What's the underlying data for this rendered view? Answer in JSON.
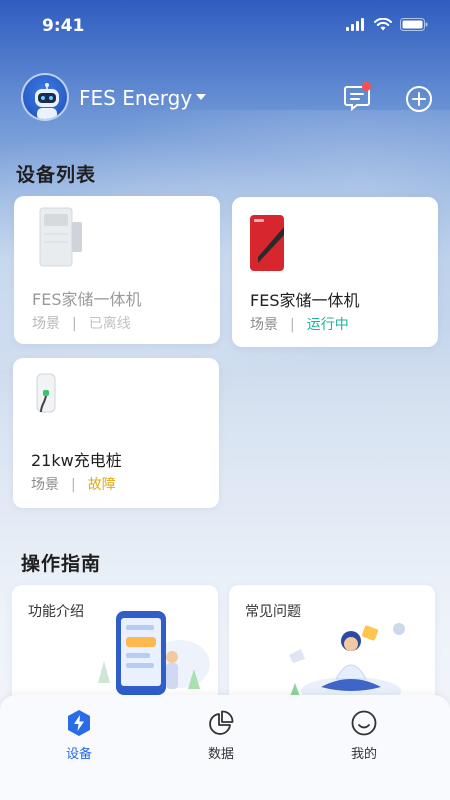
{
  "status_bar": {
    "time": "9:41"
  },
  "header": {
    "org_name": "FES Energy",
    "avatar": "robot-avatar",
    "message_icon": "message-icon",
    "add_icon": "plus-circle-icon"
  },
  "devices_section": {
    "title": "设备列表",
    "devices": [
      {
        "name": "FES家储一体机",
        "scene_label": "场景",
        "status": "已离线",
        "status_type": "offline"
      },
      {
        "name": "FES家储一体机",
        "scene_label": "场景",
        "status": "运行中",
        "status_type": "running"
      },
      {
        "name": "21kw充电桩",
        "scene_label": "场景",
        "status": "故障",
        "status_type": "fault"
      }
    ]
  },
  "guide_section": {
    "title": "操作指南",
    "cards": [
      {
        "label": "功能介绍"
      },
      {
        "label": "常见问题"
      }
    ]
  },
  "tab_bar": {
    "tabs": [
      {
        "label": "设备",
        "icon": "bolt-hexagon-icon",
        "active": true
      },
      {
        "label": "数据",
        "icon": "pie-chart-icon",
        "active": false
      },
      {
        "label": "我的",
        "icon": "smile-face-icon",
        "active": false
      }
    ]
  },
  "colors": {
    "accent": "#2a6be8",
    "running": "#1bb39a",
    "fault": "#e6a817",
    "badge": "#ff4d4f"
  }
}
